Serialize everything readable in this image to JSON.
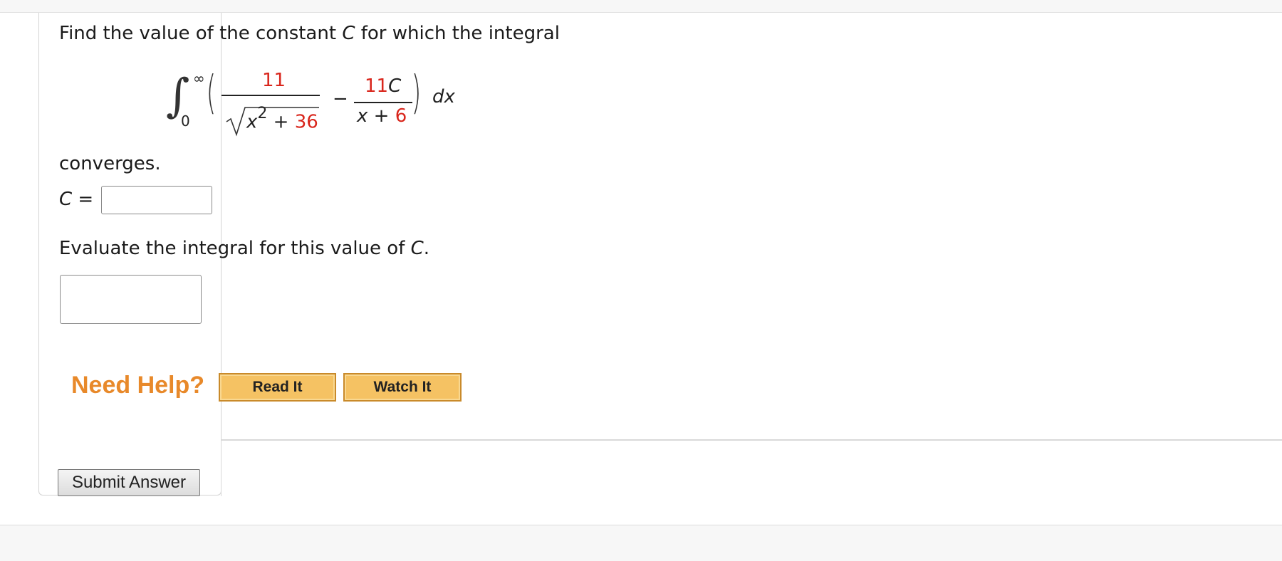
{
  "question": {
    "prompt": "Find the value of the constant",
    "prompt_var": "C",
    "prompt_end": "for which the integral",
    "converges": "converges.",
    "c_label_var": "C",
    "c_label_eq": "=",
    "c_input_value": "",
    "evaluate_text": "Evaluate the integral for this value of",
    "evaluate_var": "C",
    "evaluate_end": ".",
    "integral_input_value": ""
  },
  "integral": {
    "upper_limit": "∞",
    "lower_limit": "0",
    "term1_numerator": "11",
    "term1_denominator_base": "x",
    "term1_denominator_exp": "2",
    "term1_denominator_plus": "+",
    "term1_denominator_const": "36",
    "operator": "−",
    "term2_numerator_coef": "11",
    "term2_numerator_var": "C",
    "term2_denominator_var": "x",
    "term2_denominator_plus": "+",
    "term2_denominator_const": "6",
    "differential": "dx"
  },
  "help": {
    "label": "Need Help?",
    "read_it": "Read It",
    "watch_it": "Watch It"
  },
  "submit": {
    "label": "Submit Answer"
  },
  "colors": {
    "accent_red": "#d9261c",
    "help_orange": "#e8892a",
    "help_button": "#f5c263"
  }
}
